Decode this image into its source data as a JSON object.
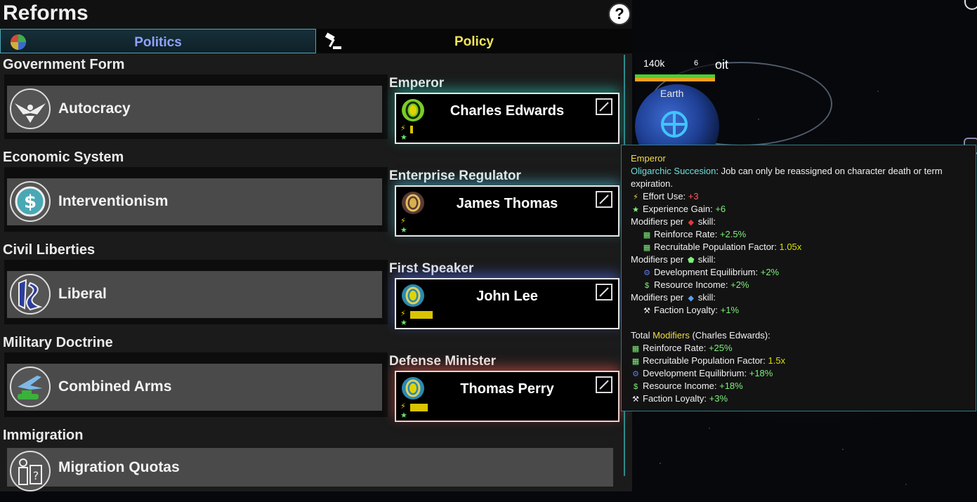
{
  "panel": {
    "title": "Reforms",
    "help_label": "?",
    "tabs": [
      {
        "label": "Politics",
        "active": true
      },
      {
        "label": "Policy",
        "active": false
      }
    ]
  },
  "sections": [
    {
      "header": "Government Form",
      "reform": "Autocracy",
      "icon": "eagle-icon"
    },
    {
      "header": "Economic System",
      "reform": "Interventionism",
      "icon": "dollar-coin-icon"
    },
    {
      "header": "Civil Liberties",
      "reform": "Liberal",
      "icon": "liberty-icon"
    },
    {
      "header": "Military Doctrine",
      "reform": "Combined Arms",
      "icon": "jet-tank-icon"
    },
    {
      "header": "Immigration",
      "reform": "Migration Quotas",
      "icon": "people-question-icon"
    }
  ],
  "jobs": [
    {
      "title": "Emperor",
      "name": "Charles Edwards",
      "skill_level": 0.1
    },
    {
      "title": "Enterprise Regulator",
      "name": "James Thomas",
      "skill_level": 0.0
    },
    {
      "title": "First Speaker",
      "name": "John Lee",
      "skill_level": 0.75
    },
    {
      "title": "Defense Minister",
      "name": "Thomas Perry",
      "skill_level": 0.6
    }
  ],
  "map": {
    "population": "140k",
    "fleet_count": "6",
    "planet_label": "Earth",
    "tag_suffix": "oit"
  },
  "tooltip": {
    "title": "Emperor",
    "succession_label": "Oligarchic Succesion",
    "succession_text": ": Job can only be reassigned on character death or term",
    "succession_text2": "expiration.",
    "effort_label": "Effort Use: ",
    "effort_value": "+3",
    "exp_label": "Experience Gain: ",
    "exp_value": "+6",
    "mod_per": "Modifiers per",
    "skill_word": "skill:",
    "groups": [
      {
        "items": [
          {
            "label": "Reinforce Rate: ",
            "value": "+2.5%",
            "color": "green"
          },
          {
            "label": "Recruitable Population Factor: ",
            "value": "1.05x",
            "color": "lime"
          }
        ]
      },
      {
        "items": [
          {
            "label": "Development Equilibrium: ",
            "value": "+2%",
            "color": "green"
          },
          {
            "label": "Resource Income: ",
            "value": "+2%",
            "color": "green"
          }
        ]
      },
      {
        "items": [
          {
            "label": "Faction Loyalty: ",
            "value": "+1%",
            "color": "green"
          }
        ]
      }
    ],
    "total_prefix": "Total ",
    "total_modifiers": "Modifiers",
    "total_suffix": " (Charles Edwards):",
    "totals": [
      {
        "label": "Reinforce Rate: ",
        "value": "+25%",
        "color": "green"
      },
      {
        "label": "Recruitable Population Factor: ",
        "value": "1.5x",
        "color": "lime"
      },
      {
        "label": "Development Equilibrium: ",
        "value": "+18%",
        "color": "green"
      },
      {
        "label": "Resource Income: ",
        "value": "+18%",
        "color": "green"
      },
      {
        "label": "Faction Loyalty: ",
        "value": "+3%",
        "color": "green"
      }
    ]
  }
}
